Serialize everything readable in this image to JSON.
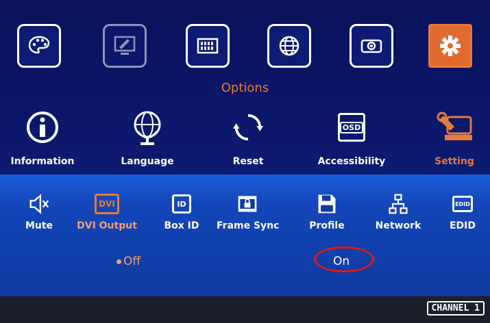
{
  "top_menu": {
    "items": [
      {
        "name": "palette-icon"
      },
      {
        "name": "display-edit-icon"
      },
      {
        "name": "keyboard-icon"
      },
      {
        "name": "globe-icon"
      },
      {
        "name": "projector-icon"
      },
      {
        "name": "gear-icon"
      }
    ],
    "active_color": "#e87a3a"
  },
  "options": {
    "title": "Options",
    "items": [
      {
        "label": "Information"
      },
      {
        "label": "Language"
      },
      {
        "label": "Reset"
      },
      {
        "label": "Accessibility",
        "icon_text": "OSD"
      },
      {
        "label": "Setting"
      }
    ]
  },
  "settings": {
    "items": [
      {
        "label": "Mute"
      },
      {
        "label": "DVI Output",
        "icon_text": "DVI"
      },
      {
        "label": "Box ID",
        "icon_text": "ID"
      },
      {
        "label": "Frame Sync"
      },
      {
        "label": "Profile"
      },
      {
        "label": "Network"
      },
      {
        "label": "EDID",
        "icon_text": "EDID"
      }
    ],
    "values": {
      "off": "Off",
      "on": "On"
    }
  },
  "footer": {
    "channel": "CHANNEL 1"
  }
}
